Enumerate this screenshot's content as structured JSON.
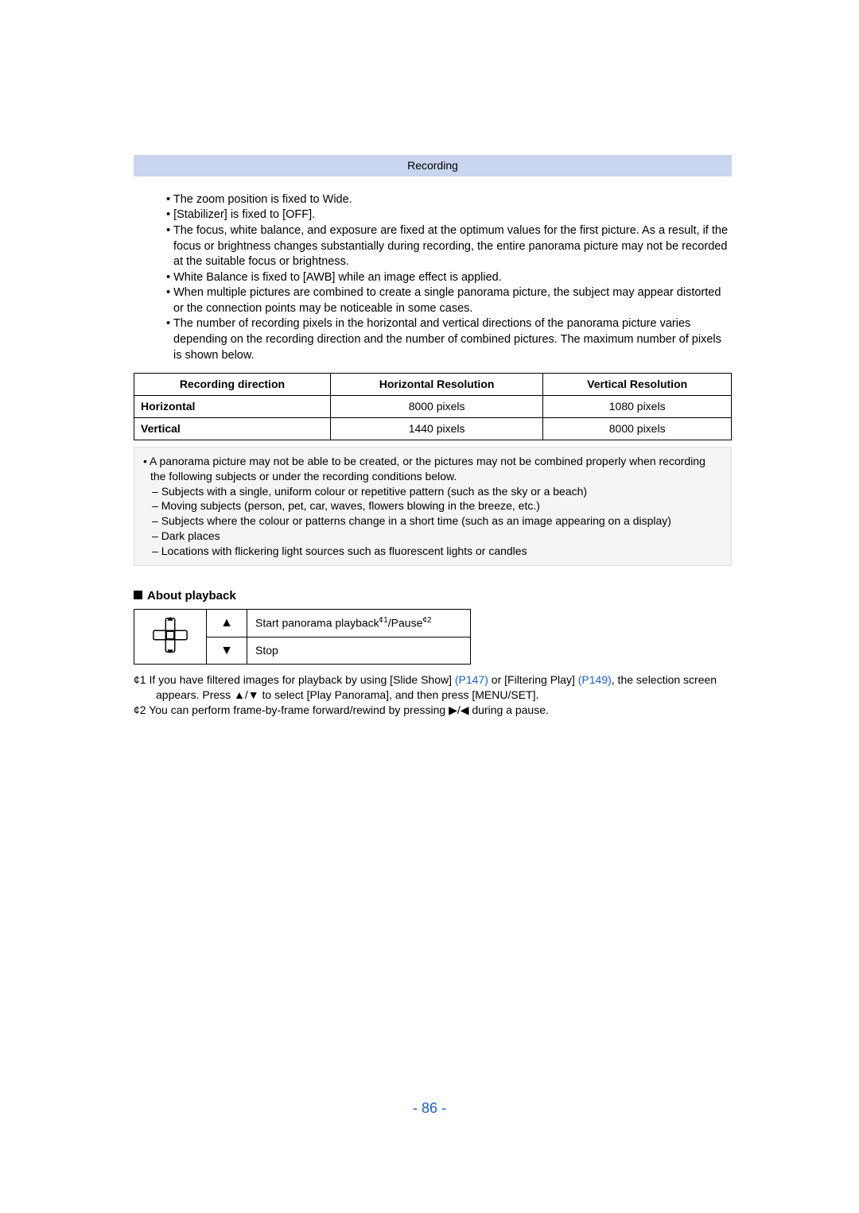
{
  "header": "Recording",
  "bullets": [
    "The zoom position is fixed to Wide.",
    "[Stabilizer] is fixed to [OFF].",
    "The focus, white balance, and exposure are fixed at the optimum values for the first picture. As a result, if the focus or brightness changes substantially during recording, the entire panorama picture may not be recorded at the suitable focus or brightness.",
    "White Balance is fixed to [AWB] while an image effect is applied.",
    "When multiple pictures are combined to create a single panorama picture, the subject may appear distorted or the connection points may be noticeable in some cases.",
    "The number of recording pixels in the horizontal and vertical directions of the panorama picture varies depending on the recording direction and the number of combined pictures. The maximum number of pixels is shown below."
  ],
  "res_table": {
    "headers": [
      "Recording direction",
      "Horizontal Resolution",
      "Vertical Resolution"
    ],
    "rows": [
      {
        "dir": "Horizontal",
        "h": "8000 pixels",
        "v": "1080 pixels"
      },
      {
        "dir": "Vertical",
        "h": "1440 pixels",
        "v": "8000 pixels"
      }
    ]
  },
  "notebox": {
    "lead": "A panorama picture may not be able to be created, or the pictures may not be combined properly when recording the following subjects or under the recording conditions below.",
    "dashes": [
      "Subjects with a single, uniform colour or repetitive pattern (such as the sky or a beach)",
      "Moving subjects (person, pet, car, waves, flowers blowing in the breeze, etc.)",
      "Subjects where the colour or patterns change in a short time (such as an image appearing on a display)",
      "Dark places",
      "Locations with flickering light sources such as fluorescent lights or candles"
    ]
  },
  "playback": {
    "heading": "About playback",
    "rows": [
      {
        "sym": "▲",
        "desc_pre": "Start panorama playback",
        "sup1": "¢1",
        "desc_mid": "/Pause",
        "sup2": "¢2"
      },
      {
        "sym": "▼",
        "desc": "Stop"
      }
    ]
  },
  "footnotes": {
    "f1_pre": "¢1 If you have filtered images for playback by using [Slide Show] ",
    "f1_link1": "(P147)",
    "f1_mid": " or [Filtering Play] ",
    "f1_link2": "(P149)",
    "f1_post": ", the selection screen appears. Press ▲/▼ to select [Play Panorama], and then press [MENU/SET].",
    "f2": "¢2 You can perform frame-by-frame forward/rewind by pressing ▶/◀ during a pause."
  },
  "page_number": "- 86 -"
}
